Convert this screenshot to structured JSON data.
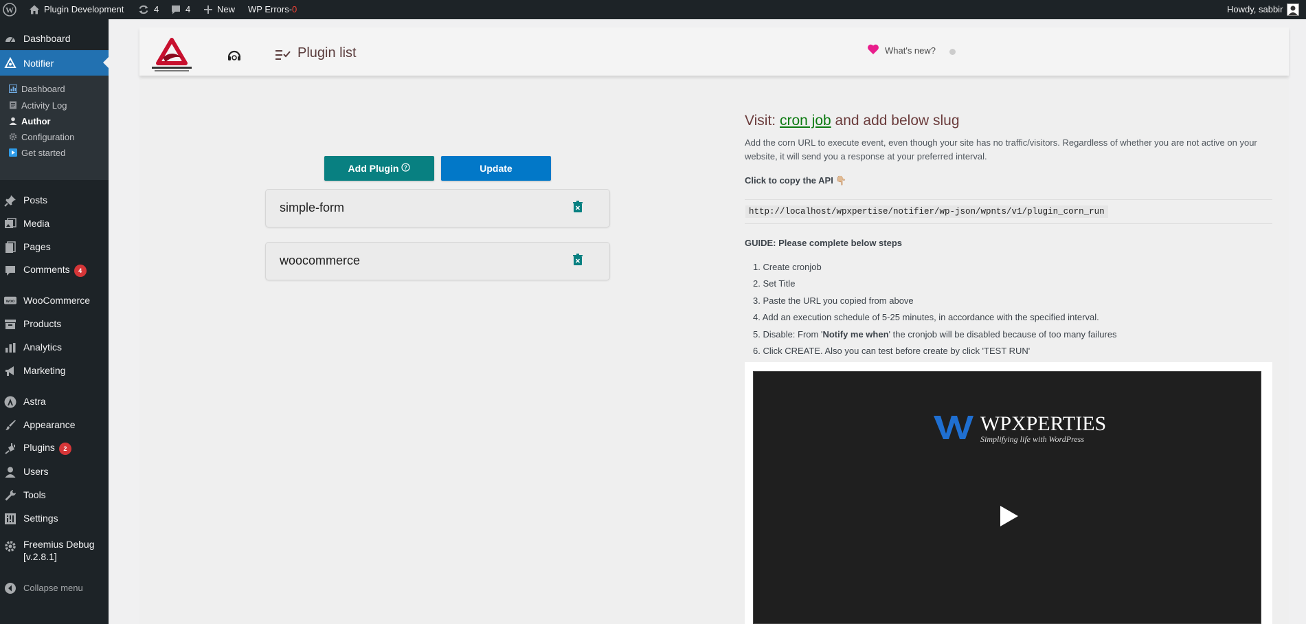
{
  "admin_bar": {
    "site_name": "Plugin Development",
    "updates_count": "4",
    "comments_count": "4",
    "new_label": "New",
    "wp_errors_label": "WP Errors-",
    "wp_errors_count": "0",
    "howdy": "Howdy, sabbir"
  },
  "sidebar": {
    "dashboard": "Dashboard",
    "notifier": "Notifier",
    "submenu": {
      "dashboard": "Dashboard",
      "activity_log": "Activity Log",
      "author": "Author",
      "configuration": "Configuration",
      "get_started": "Get started"
    },
    "posts": "Posts",
    "media": "Media",
    "pages": "Pages",
    "comments": "Comments",
    "comments_badge": "4",
    "woocommerce": "WooCommerce",
    "products": "Products",
    "analytics": "Analytics",
    "marketing": "Marketing",
    "astra": "Astra",
    "appearance": "Appearance",
    "plugins": "Plugins",
    "plugins_badge": "2",
    "users": "Users",
    "tools": "Tools",
    "settings": "Settings",
    "freemius_line1": "Freemius Debug",
    "freemius_line2": "[v.2.8.1]",
    "collapse": "Collapse menu"
  },
  "header": {
    "title": "Plugin list",
    "whats_new": "What's new?"
  },
  "actions": {
    "add_plugin": "Add Plugin",
    "update": "Update"
  },
  "plugins": [
    {
      "name": "simple-form"
    },
    {
      "name": "woocommerce"
    }
  ],
  "cron": {
    "visit_prefix": "Visit:",
    "link_text": "cron job",
    "visit_suffix": "and add below slug",
    "description": "Add the corn URL to execute event, even though your site has no traffic/visitors. Regardless of whether you are not active on your website, it will send you a response at your preferred interval.",
    "copy_label": "Click to copy the API 👇🏼",
    "api_url": "http://localhost/wpxpertise/notifier/wp-json/wpnts/v1/plugin_corn_run",
    "guide_label": "GUIDE: Please complete below steps",
    "steps": [
      "1. Create cronjob",
      "2. Set Title",
      "3. Paste the URL you copied from above",
      "4. Add an execution schedule of 5-25 minutes, in accordance with the specified interval.",
      "6. Click CREATE. Also you can test before create by click 'TEST RUN'"
    ],
    "step5_prefix": "5. Disable: From '",
    "step5_bold": "Notify me when",
    "step5_suffix": "' the cronjob will be disabled because of too many failures"
  },
  "video": {
    "brand_name": "WPXPERTIES",
    "brand_tagline": "Simplifying life with WordPress"
  },
  "colors": {
    "admin_dark": "#1d2327",
    "active_blue": "#2271b1",
    "teal": "#088081",
    "blue": "#0278c8",
    "badge_red": "#d63638",
    "link_green": "#0b7a10"
  }
}
